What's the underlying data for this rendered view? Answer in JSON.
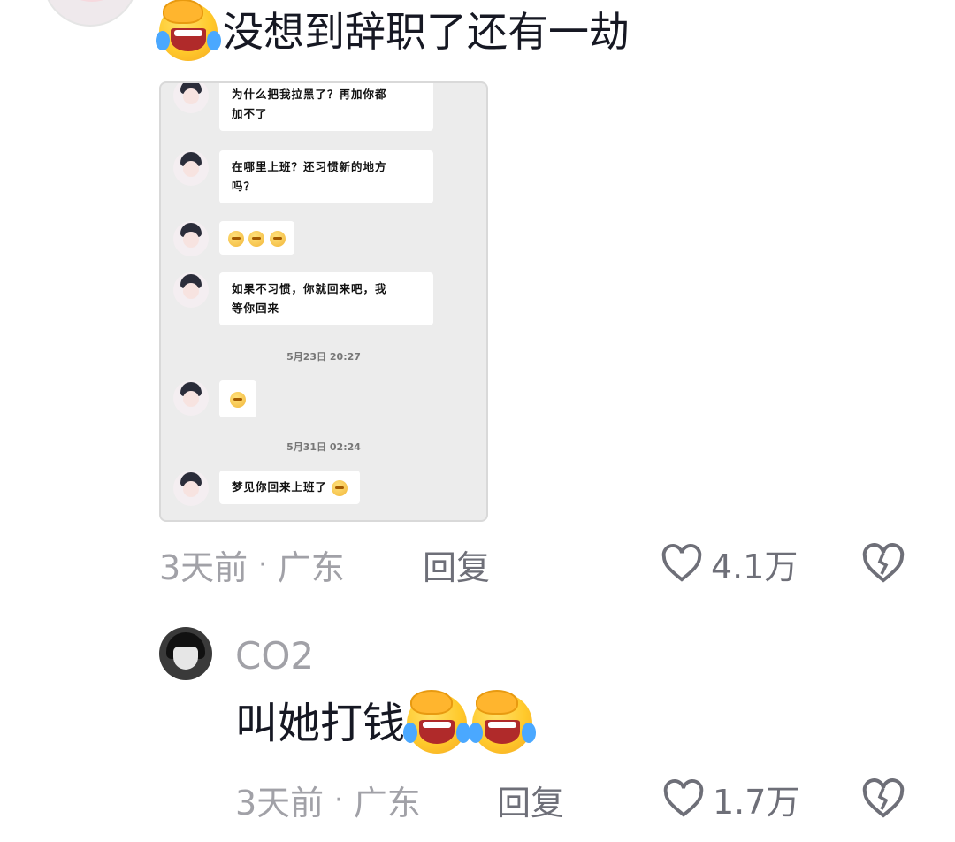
{
  "comment": {
    "text": "没想到辞职了还有一劫",
    "emoji_prefix": "facepalm-crying-emoji",
    "meta_time": "3天前",
    "meta_sep": "·",
    "meta_location": "广东",
    "reply_label": "回复",
    "like_count": "4.1万",
    "screenshot": {
      "messages": [
        {
          "lines": [
            "为什么把我拉黑了？再加你都",
            "加不了"
          ]
        },
        {
          "lines": [
            "在哪里上班？还习惯新的地方",
            "吗？"
          ]
        },
        {
          "emojis": 3
        },
        {
          "lines": [
            "如果不习惯，你就回来吧，我",
            "等你回来"
          ]
        },
        {
          "timestamp": "5月23日 20:27"
        },
        {
          "emojis": 1
        },
        {
          "timestamp": "5月31日 02:24"
        },
        {
          "text": "梦见你回来上班了"
        }
      ]
    }
  },
  "reply": {
    "username": "CO2",
    "text": "叫她打钱",
    "emoji_suffix": [
      "facepalm-crying-emoji",
      "facepalm-crying-emoji"
    ],
    "meta_time": "3天前",
    "meta_sep": "·",
    "meta_location": "广东",
    "reply_label": "回复",
    "like_count": "1.7万"
  },
  "icons": {
    "like": "heart-outline-icon",
    "dislike": "broken-heart-icon"
  },
  "colors": {
    "text_primary": "#161823",
    "text_secondary": "#a1a1a7",
    "action_gray": "#6e6f78"
  }
}
